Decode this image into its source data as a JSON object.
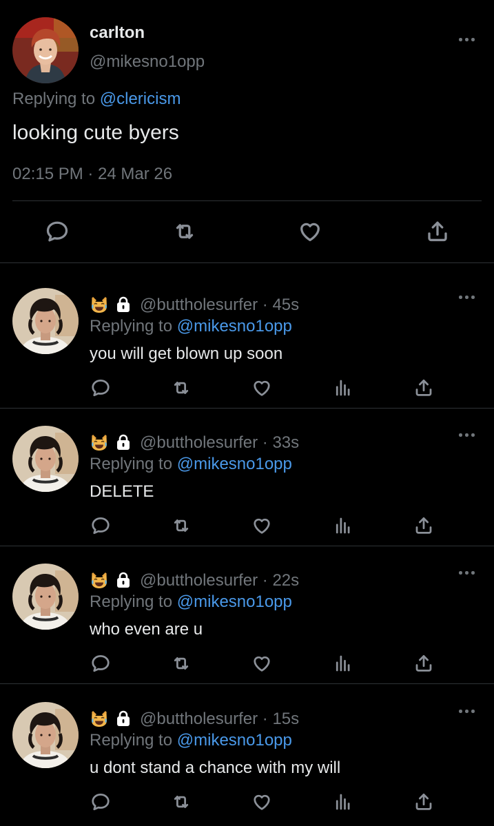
{
  "main_tweet": {
    "display_name": "carlton",
    "handle": "@mikesno1opp",
    "replying_prefix": "Replying to",
    "replying_to": "@clericism",
    "text": "looking cute byers",
    "timestamp": "02:15 PM · 24 Mar 26"
  },
  "replies": [
    {
      "handle": "@buttholesurfer",
      "age": "· 45s",
      "replying_prefix": "Replying to",
      "replying_to": "@mikesno1opp",
      "text": "you will get blown up soon"
    },
    {
      "handle": "@buttholesurfer",
      "age": "· 33s",
      "replying_prefix": "Replying to",
      "replying_to": "@mikesno1opp",
      "text": "DELETE"
    },
    {
      "handle": "@buttholesurfer",
      "age": "· 22s",
      "replying_prefix": "Replying to",
      "replying_to": "@mikesno1opp",
      "text": "who even are u"
    },
    {
      "handle": "@buttholesurfer",
      "age": "· 15s",
      "replying_prefix": "Replying to",
      "replying_to": "@mikesno1opp",
      "text": "u dont stand a chance with my will"
    }
  ],
  "icons": {
    "reply": "speech-bubble-icon",
    "retweet": "retweet-icon",
    "like": "heart-icon",
    "views": "bar-chart-icon",
    "share": "share-icon",
    "more": "more-dots-icon",
    "emoji": "cat-laughing-emoji",
    "lock": "lock-icon"
  },
  "colors": {
    "background": "#000000",
    "text": "#e7e9ea",
    "muted": "#71767b",
    "mention": "#4a99e9",
    "divider": "#2f3336"
  }
}
